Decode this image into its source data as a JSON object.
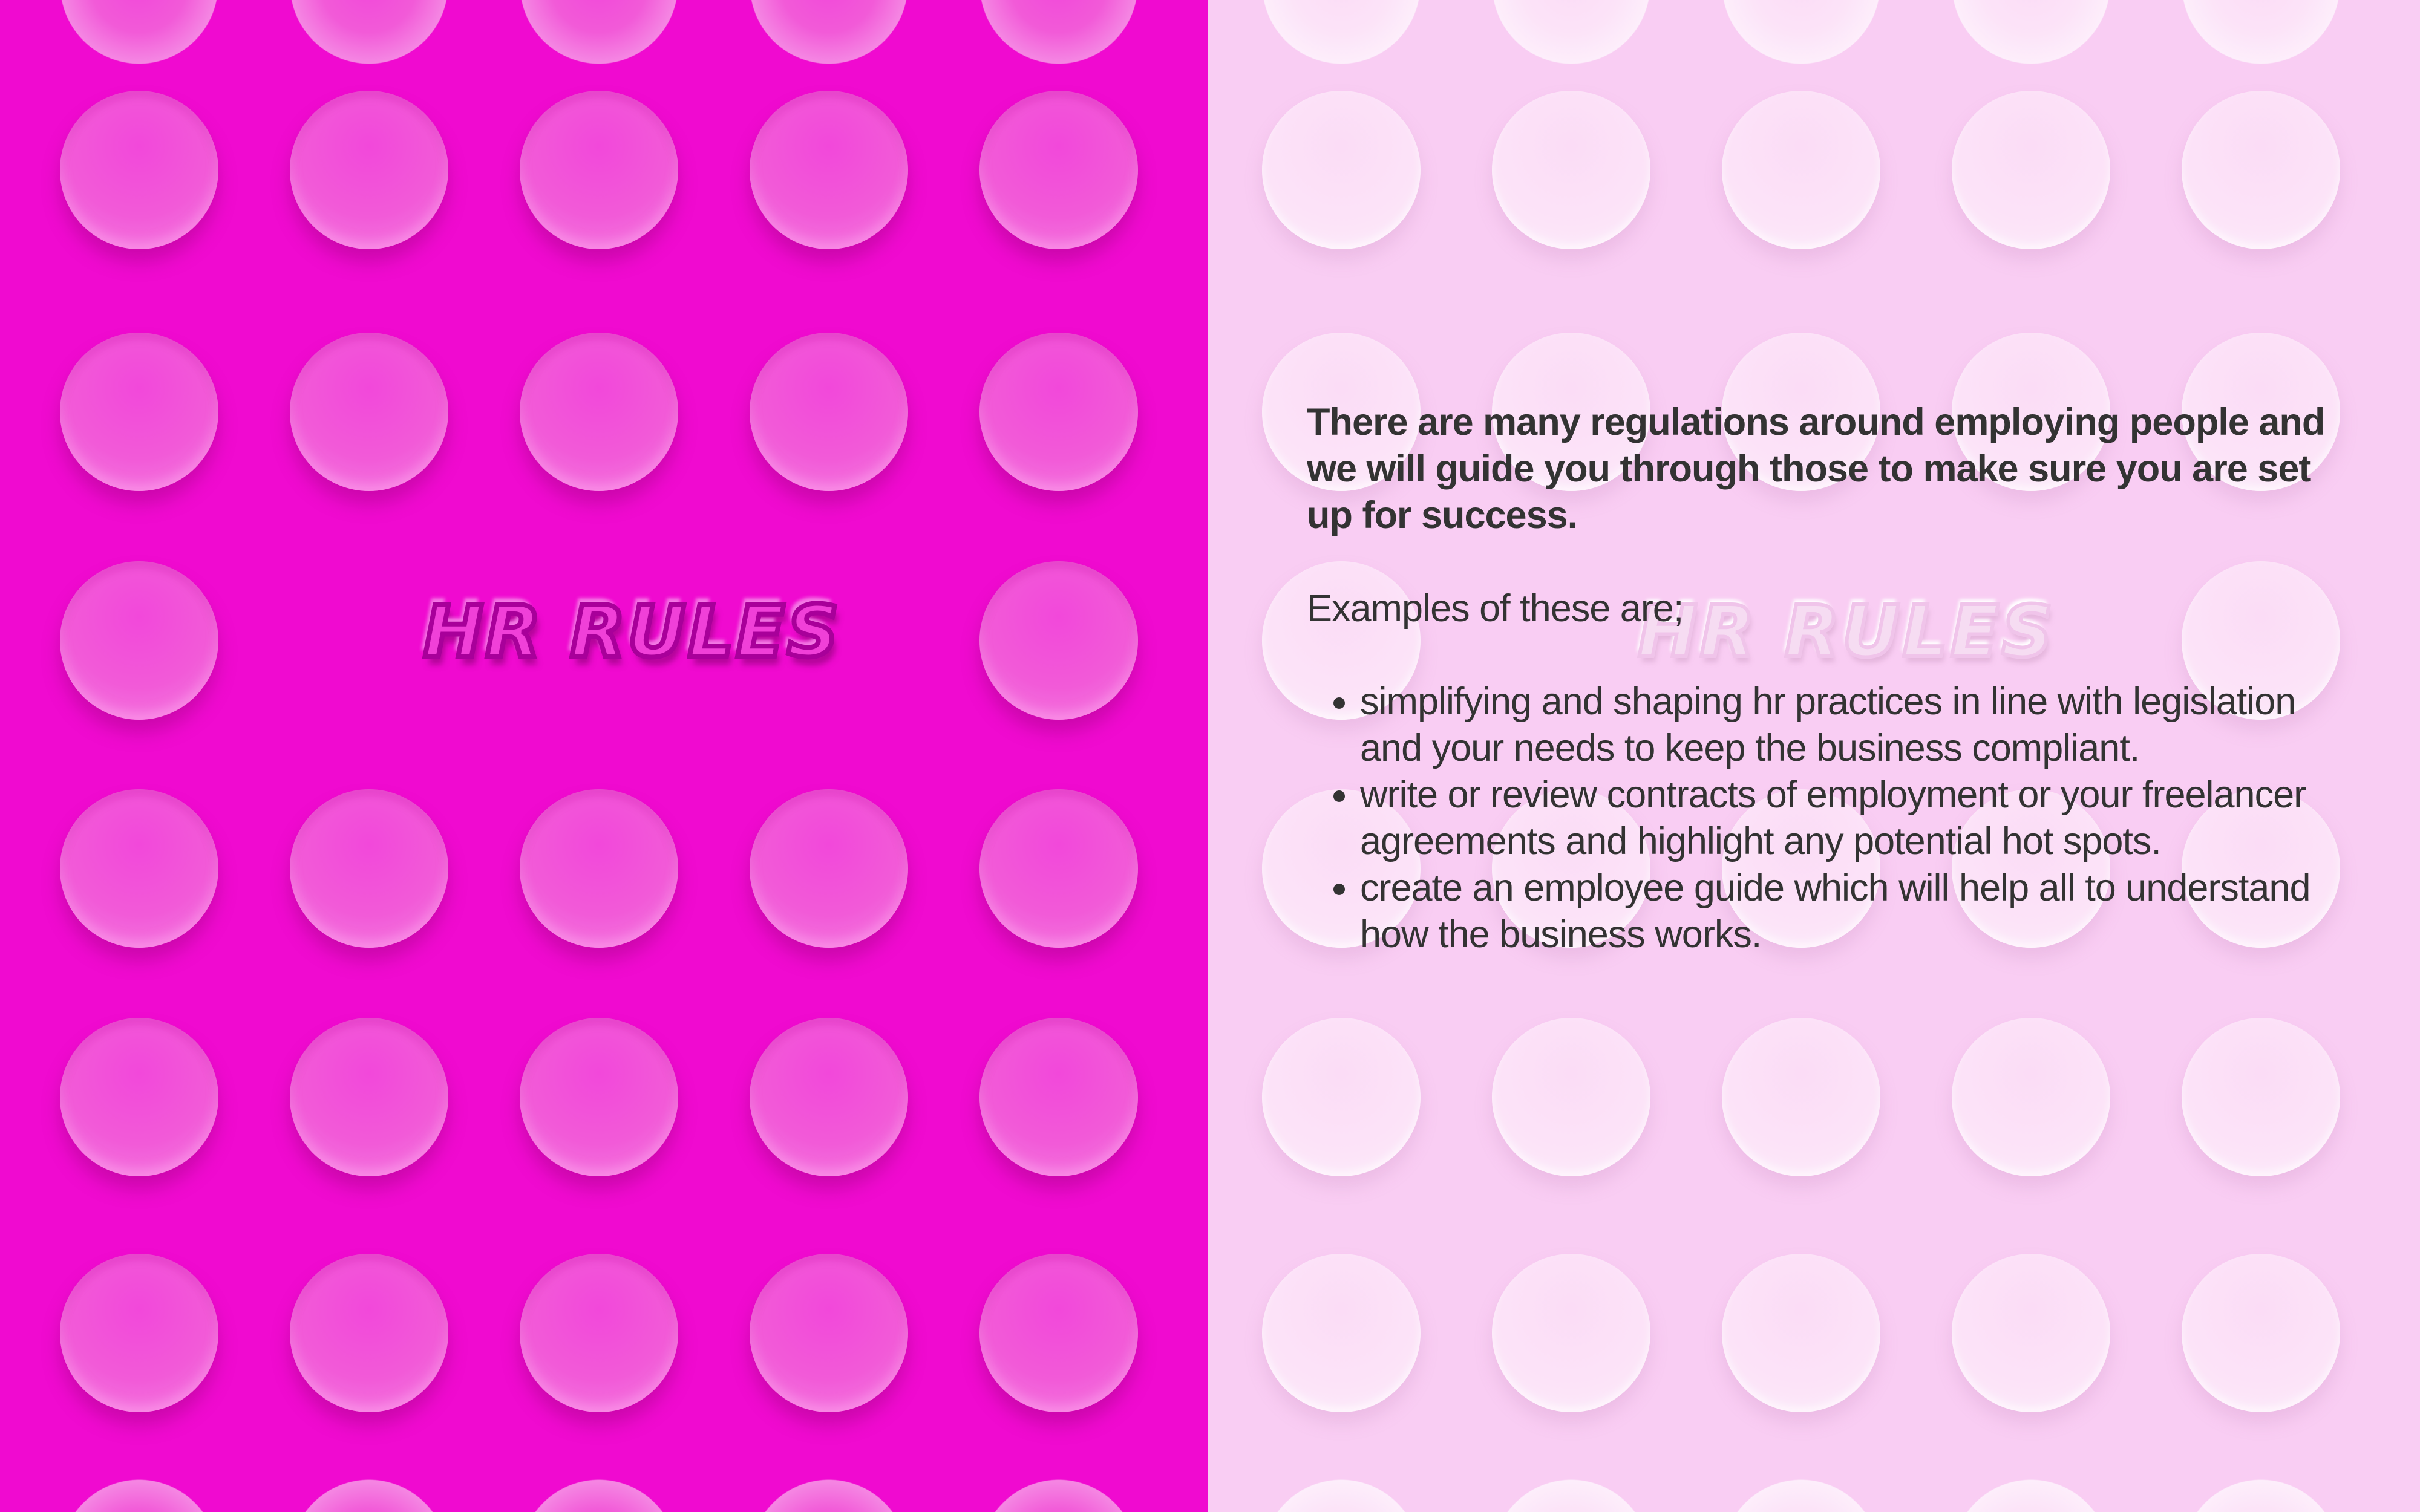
{
  "colors": {
    "left_background": "#f00ad0",
    "right_background": "#f9cdf3",
    "text": "#333333"
  },
  "logo": {
    "text": "HR RULES"
  },
  "content": {
    "intro": "There are many regulations around employing people and we will guide you through those to make sure you are set up for success.",
    "lead": "Examples of these are;",
    "bullets": [
      "simplifying and shaping hr practices in line with legislation and your needs to keep the business compliant.",
      "write or review contracts of employment or your freelancer agreements and highlight any potential hot spots.",
      "create an employee guide which will help all to understand how the business works."
    ]
  }
}
